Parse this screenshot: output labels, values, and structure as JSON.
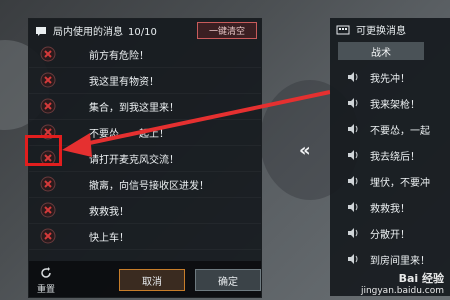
{
  "left_panel": {
    "title": "局内使用的消息",
    "count": "10/10",
    "clear_label": "一键清空",
    "messages": [
      "前方有危险！",
      "我这里有物资！",
      "集合，到我这里来！",
      "不要怂，一起上！",
      "请打开麦克风交流！",
      "撤离，向信号接收区进发！",
      "救救我！",
      "快上车！"
    ],
    "reset_label": "重置",
    "cancel_label": "取消",
    "confirm_label": "确定"
  },
  "middle": {
    "transfer_arrow": "«"
  },
  "right_panel": {
    "title": "可更换消息",
    "tab_label": "战术",
    "messages": [
      "我先冲！",
      "我来架枪！",
      "不要怂，一起",
      "我去绕后！",
      "埋伏，不要冲",
      "救救我！",
      "分散开！",
      "到房间里来！"
    ]
  },
  "watermark": {
    "logo": "Bai 经验",
    "url": "jingyan.baidu.com"
  },
  "colors": {
    "highlight": "#e21e1e",
    "remove": "#d33a3a",
    "panel": "#161a1e"
  },
  "icons": [
    "chat-icon",
    "remove-icon",
    "refresh-icon",
    "speaker-icon",
    "keyboard-icon"
  ]
}
